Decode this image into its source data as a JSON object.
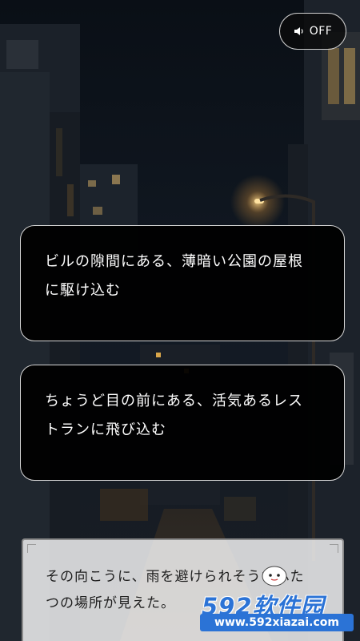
{
  "sound": {
    "icon": "speaker-icon",
    "label": "OFF"
  },
  "choices": [
    {
      "line1": "ビルの隙間にある、薄暗い公園の屋根",
      "line2": "に駆け込む"
    },
    {
      "line1": "ちょうど目の前にある、活気あるレス",
      "line2": "トランに飛び込む"
    }
  ],
  "dialogue": {
    "line1": "その向こうに、雨を避けられそうなふた",
    "line2": "つの場所が見えた。"
  },
  "watermark": {
    "top": "592软件园",
    "bottom": "www.592xiazai.com"
  }
}
